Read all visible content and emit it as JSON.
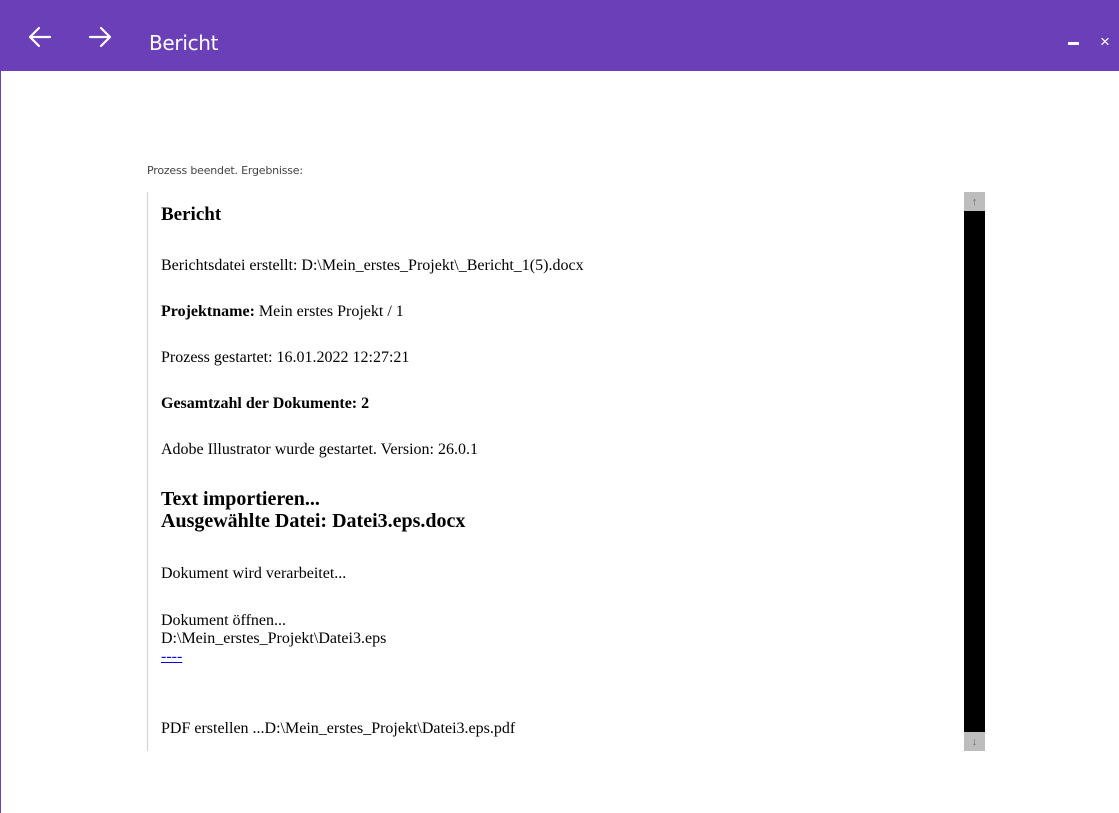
{
  "window": {
    "title": "Bericht",
    "accent_color": "#6a3fb8",
    "close_glyph": "×"
  },
  "status": {
    "label": "Prozess beendet. Ergebnisse:"
  },
  "report": {
    "heading": "Bericht",
    "report_file_line": "Berichtsdatei erstellt: D:\\Mein_erstes_Projekt\\_Bericht_1(5).docx",
    "project_name_label": "Projektname:",
    "project_name_value": " Mein erstes Projekt / 1",
    "process_started": "Prozess gestartet: 16.01.2022 12:27:21",
    "total_documents": "Gesamtzahl der Dokumente: 2",
    "illustrator_started": "Adobe Illustrator wurde gestartet. Version: 26.0.1",
    "import_text": "Text importieren...",
    "selected_file": "Ausgewählte Datei: Datei3.eps.docx",
    "processing": "Dokument wird verarbeitet...",
    "open_document": "Dokument öffnen...",
    "open_document_path": "D:\\Mein_erstes_Projekt\\Datei3.eps",
    "separator_link": "----",
    "create_pdf": "PDF erstellen ...D:\\Mein_erstes_Projekt\\Datei3.eps.pdf"
  },
  "scrollbar": {
    "up_glyph": "↑",
    "down_glyph": "↓"
  },
  "icons": {
    "back": "arrow-left-icon",
    "forward": "arrow-right-icon",
    "minimize": "minimize-icon",
    "close": "close-icon"
  }
}
